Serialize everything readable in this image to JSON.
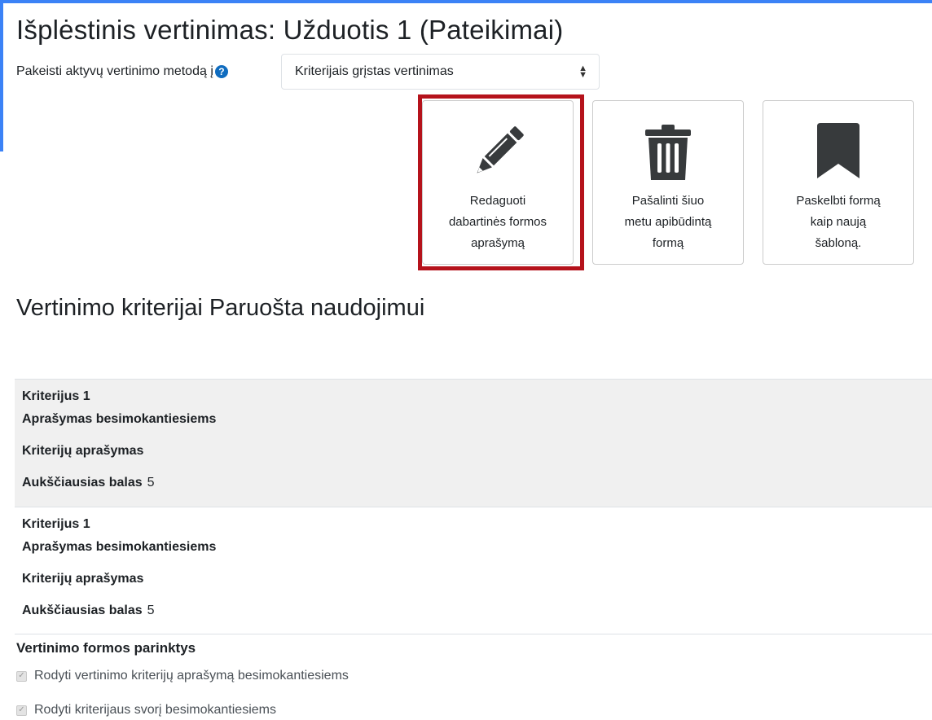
{
  "page": {
    "title": "Išplėstinis vertinimas: Užduotis 1 (Pateikimai)",
    "accent_color": "#0f6cbf",
    "highlight_color": "#b5121b"
  },
  "method": {
    "label": "Pakeisti aktyvų vertinimo metodą į",
    "help_icon": "question-circle-icon",
    "selected": "Kriterijais grįstas vertinimas"
  },
  "actions": [
    {
      "label_line1": "Redaguoti",
      "label_line2": "dabartinės formos",
      "label_line3": "aprašymą",
      "icon": "pencil-icon"
    },
    {
      "label_line1": "Pašalinti šiuo",
      "label_line2": "metu apibūdintą",
      "label_line3": "formą",
      "icon": "trash-icon"
    },
    {
      "label_line1": "Paskelbti formą",
      "label_line2": "kaip naują",
      "label_line3": "šabloną.",
      "icon": "bookmark-icon"
    }
  ],
  "section": {
    "title": "Vertinimo kriterijai Paruošta naudojimui"
  },
  "criteria": [
    {
      "name": "Kriterijus 1",
      "desc_students": "Aprašymas besimokantiesiems",
      "desc_criteria": "Kriterijų aprašymas",
      "max_label": "Aukščiausias balas",
      "max_value": "5"
    },
    {
      "name": "Kriterijus 1",
      "desc_students": "Aprašymas besimokantiesiems",
      "desc_criteria": "Kriterijų aprašymas",
      "max_label": "Aukščiausias balas",
      "max_value": "5"
    }
  ],
  "options": {
    "title": "Vertinimo formos parinktys",
    "items": [
      {
        "label": "Rodyti vertinimo kriterijų aprašymą besimokantiesiems",
        "checked": true
      },
      {
        "label": "Rodyti kriterijaus svorį besimokantiesiems",
        "checked": true
      }
    ]
  }
}
